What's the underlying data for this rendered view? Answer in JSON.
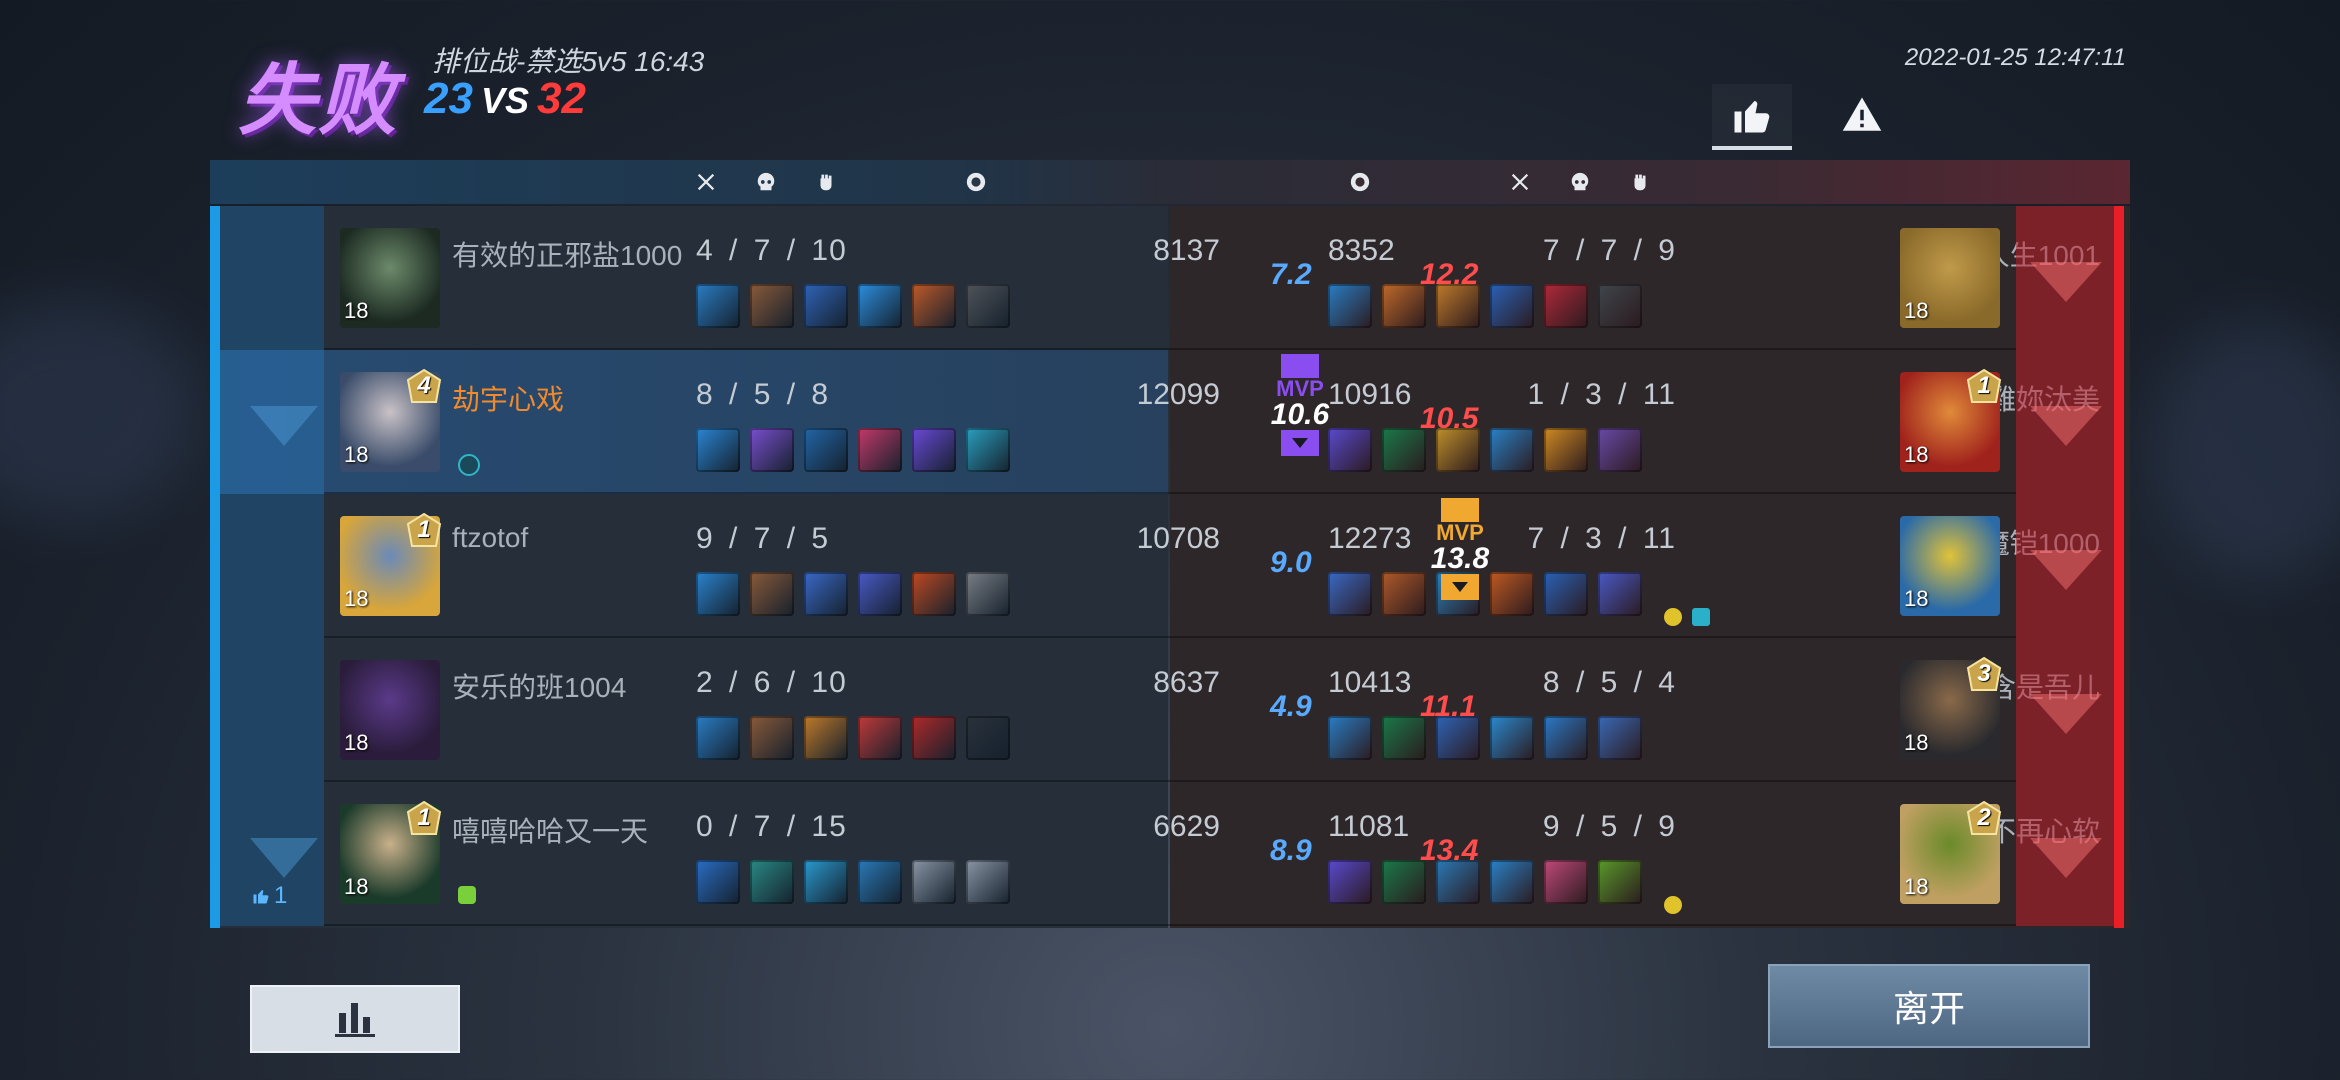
{
  "header": {
    "result": "失败",
    "mode_and_duration": "排位战-禁选5v5  16:43",
    "score_blue": "23",
    "score_vs": "VS",
    "score_red": "32",
    "datetime": "2022-01-25  12:47:11"
  },
  "colors": {
    "blue_team": "#1b9ae6",
    "red_team": "#e81f27",
    "self_name": "#f08a2c",
    "mvp_loser": "#8a4df0",
    "mvp_winner": "#f0a830"
  },
  "blue_team": [
    {
      "name": "有效的正邪盐1000",
      "level": "18",
      "rank": "",
      "kda": "4 / 7 / 10",
      "gold": "8137",
      "rating": "7.2",
      "items": [
        "#2a7ec6",
        "#8a5a3a",
        "#2f64b8",
        "#2c8fe0",
        "#c05a2a",
        "#50545a"
      ],
      "is_self": false
    },
    {
      "name": "劫宇心戏",
      "level": "18",
      "rank": "4",
      "kda": "8 / 5 / 8",
      "gold": "12099",
      "rating": "10.6",
      "items": [
        "#2a86d6",
        "#7a4fd0",
        "#2266a8",
        "#c43a6a",
        "#6a4ad8",
        "#2aa0c0"
      ],
      "is_self": true
    },
    {
      "name": "ftzotof",
      "level": "18",
      "rank": "1",
      "kda": "9 / 7 / 5",
      "gold": "10708",
      "rating": "9.0",
      "items": [
        "#2a84d0",
        "#8a5a3a",
        "#3a6ac8",
        "#4a5ac8",
        "#c04a22",
        "#7a7f86"
      ],
      "is_self": false
    },
    {
      "name": "安乐的班1004",
      "level": "18",
      "rank": "",
      "kda": "2 / 6 / 10",
      "gold": "8637",
      "rating": "4.9",
      "items": [
        "#2a7ec6",
        "#8a5a3a",
        "#c07a2a",
        "#c03a3a",
        "#b02a2a",
        "#2a323c"
      ],
      "is_self": false
    },
    {
      "name": "嘻嘻哈哈又一天",
      "level": "18",
      "rank": "1",
      "kda": "0 / 7 / 15",
      "gold": "6629",
      "rating": "8.9",
      "items": [
        "#2a6ec6",
        "#2a8a86",
        "#2a9ad0",
        "#2a7ab8",
        "#8a96a6",
        "#8a96a6"
      ],
      "is_self": false
    }
  ],
  "red_team": [
    {
      "name": "孤独人生1001",
      "level": "18",
      "rank": "",
      "kda": "7 / 7 / 9",
      "gold": "8352",
      "rating": "12.2",
      "items": [
        "#2a7ec6",
        "#c06a2a",
        "#c07a2a",
        "#2a62b8",
        "#b02a3a",
        "#40464c"
      ]
    },
    {
      "name": "雞妳汰美",
      "level": "18",
      "rank": "1",
      "kda": "1 / 3 / 11",
      "gold": "10916",
      "rating": "10.5",
      "items": [
        "#5a4ad0",
        "#1a7a4a",
        "#c0902a",
        "#2a82c8",
        "#d08a22",
        "#6a4aa8"
      ]
    },
    {
      "name": "小魔铠1000",
      "level": "18",
      "rank": "",
      "kda": "7 / 3 / 11",
      "gold": "12273",
      "rating": "13.8",
      "items": [
        "#3a6ac8",
        "#b05a2a",
        "#2a82c0",
        "#c05a22",
        "#2a62b8",
        "#4a5ac8"
      ]
    },
    {
      "name": "董诗含是吾儿",
      "level": "18",
      "rank": "3",
      "kda": "8 / 5 / 4",
      "gold": "10413",
      "rating": "11.1",
      "items": [
        "#2a7ec6",
        "#1a7a4a",
        "#2f64b8",
        "#2a8ad0",
        "#2a7ac8",
        "#3a6ab8"
      ]
    },
    {
      "name": "握拳不再心软",
      "level": "18",
      "rank": "2",
      "kda": "9 / 5 / 9",
      "gold": "11081",
      "rating": "13.4",
      "items": [
        "#5a4ad0",
        "#1a7a4a",
        "#2a7ab8",
        "#2a82c8",
        "#c04a7a",
        "#5a9a2a"
      ]
    }
  ],
  "mvp": {
    "loser": {
      "label": "MVP",
      "value": "10.6"
    },
    "winner": {
      "label": "MVP",
      "value": "13.8"
    }
  },
  "like_count": "1",
  "buttons": {
    "leave": "离开"
  },
  "icons": {
    "like": "thumbs-up-icon",
    "report": "warning-icon",
    "kills": "crossed-swords-icon",
    "deaths": "skull-icon",
    "assists": "fist-icon",
    "gold": "coin-icon",
    "stats": "bar-chart-icon"
  }
}
